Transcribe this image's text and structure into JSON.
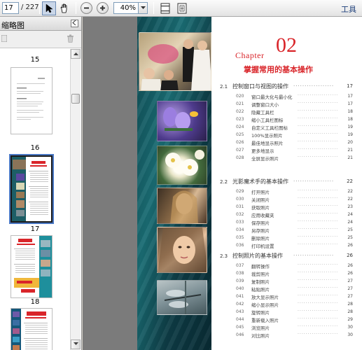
{
  "toolbar": {
    "current_page": "17",
    "total_pages": "/ 227",
    "zoom": "40%",
    "tools_label": "工具"
  },
  "panel": {
    "title": "缩略图",
    "thumbs": [
      {
        "label": "15"
      },
      {
        "label": "16"
      },
      {
        "label": "17"
      },
      {
        "label": "18"
      }
    ]
  },
  "page": {
    "chapter_word": "Chapter",
    "chapter_num": "02",
    "chapter_title": "掌握常用的基本操作",
    "sections": [
      {
        "num": "2.1",
        "title": "控制窗口与视图的操作",
        "page": "17",
        "items": [
          {
            "num": "020",
            "title": "窗口最大化与最小化",
            "page": "17"
          },
          {
            "num": "021",
            "title": "调整窗口大小",
            "page": "17"
          },
          {
            "num": "022",
            "title": "隐藏工具栏",
            "page": "18"
          },
          {
            "num": "023",
            "title": "缩小工具栏图标",
            "page": "18"
          },
          {
            "num": "024",
            "title": "自定义工具栏图标",
            "page": "19"
          },
          {
            "num": "025",
            "title": "100%显示照片",
            "page": "19"
          },
          {
            "num": "026",
            "title": "最佳地显示照片",
            "page": "20"
          },
          {
            "num": "027",
            "title": "更多地显示",
            "page": "21"
          },
          {
            "num": "028",
            "title": "全屏显示照片",
            "page": "21"
          }
        ]
      },
      {
        "num": "2.2",
        "title": "光影魔术手的基本操作",
        "page": "22",
        "items": [
          {
            "num": "029",
            "title": "打开照片",
            "page": "22"
          },
          {
            "num": "030",
            "title": "关闭照片",
            "page": "22"
          },
          {
            "num": "031",
            "title": "获取照片",
            "page": "23"
          },
          {
            "num": "032",
            "title": "应用收藏夹",
            "page": "24"
          },
          {
            "num": "033",
            "title": "保存照片",
            "page": "24"
          },
          {
            "num": "034",
            "title": "另存照片",
            "page": "25"
          },
          {
            "num": "035",
            "title": "删除照片",
            "page": "25"
          },
          {
            "num": "036",
            "title": "打印机设置",
            "page": "26"
          }
        ]
      },
      {
        "num": "2.3",
        "title": "控制照片的基本操作",
        "page": "26",
        "items": [
          {
            "num": "037",
            "title": "翻转操作",
            "page": "26"
          },
          {
            "num": "038",
            "title": "裁剪照片",
            "page": "26"
          },
          {
            "num": "039",
            "title": "复制照片",
            "page": "27"
          },
          {
            "num": "040",
            "title": "粘贴照片",
            "page": "27"
          },
          {
            "num": "041",
            "title": "放大显示照片",
            "page": "27"
          },
          {
            "num": "042",
            "title": "缩小显示照片",
            "page": "28"
          },
          {
            "num": "043",
            "title": "旋转照片",
            "page": "28"
          },
          {
            "num": "044",
            "title": "重新载入照片",
            "page": "29"
          },
          {
            "num": "045",
            "title": "浏览照片",
            "page": "30"
          },
          {
            "num": "046",
            "title": "对比照片",
            "page": "30"
          }
        ]
      }
    ]
  }
}
